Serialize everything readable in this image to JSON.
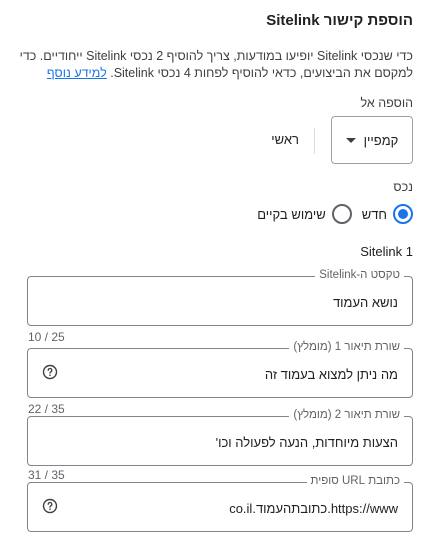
{
  "header": {
    "title": "הוספת קישור Sitelink"
  },
  "intro": {
    "text": "כדי שנכסי Sitelink יופיעו במודעות, צריך להוסיף 2 נכסי Sitelink ייחודיים. כדי למקסם את הביצועים, כדאי להוסיף לפחות 4 נכסי Sitelink. ",
    "link": "למידע נוסף"
  },
  "add_to": {
    "label": "הוספה אל",
    "select_value": "קמפיין",
    "target": "ראשי"
  },
  "asset": {
    "label": "נכס",
    "options": [
      {
        "label": "חדש",
        "checked": true
      },
      {
        "label": "שימוש בקיים",
        "checked": false
      }
    ]
  },
  "sitelink": {
    "section_title": "Sitelink 1",
    "fields": {
      "text": {
        "label": "טקסט ה-Sitelink",
        "value": "נושא העמוד",
        "counter": "10 / 25"
      },
      "desc1": {
        "label": "שורת תיאור 1 (מומלץ)",
        "value": "מה ניתן למצוא בעמוד זה",
        "counter": "22 / 35"
      },
      "desc2": {
        "label": "שורת תיאור 2 (מומלץ)",
        "value": "הצעות מיוחדות, הנעה לפעולה וכו'",
        "counter": "31 / 35"
      },
      "url": {
        "label": "כתובת URL סופית",
        "value": "https://www.כתובתהעמוד.co.il"
      }
    }
  },
  "colors": {
    "accent": "#1a73e8",
    "text": "#202124",
    "muted": "#5f6368",
    "border": "#80868b"
  },
  "icons": {
    "help": "help-circle-icon",
    "dropdown": "caret-down-icon"
  }
}
